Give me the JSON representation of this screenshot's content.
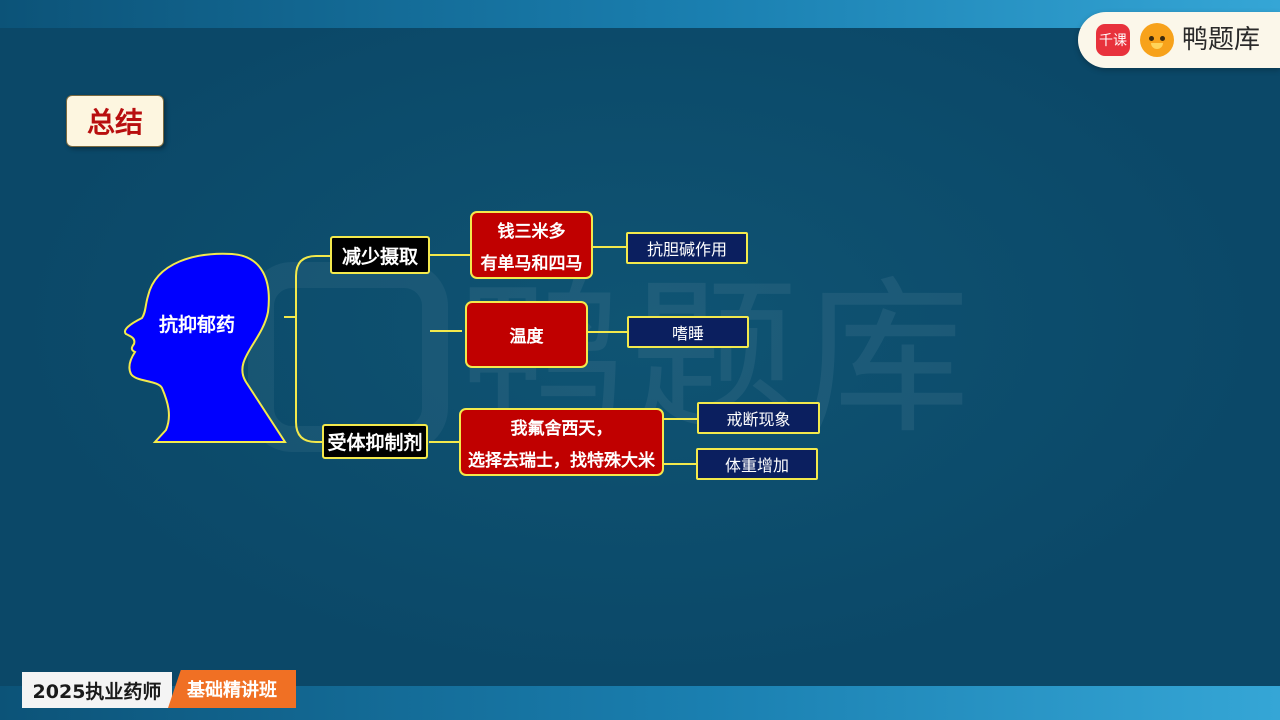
{
  "brand": {
    "badge": "千课",
    "name": "鸭题库"
  },
  "summary_label": "总结",
  "watermark": "鸭题库",
  "mindmap": {
    "root": "抗抑郁药",
    "branches": [
      {
        "label": "减少摄取",
        "mnemonic": [
          "钱三米多",
          "有单马和四马"
        ],
        "effects": [
          "抗胆碱作用"
        ]
      },
      {
        "label": "",
        "mnemonic": [
          "温度"
        ],
        "effects": [
          "嗜睡"
        ]
      },
      {
        "label": "受体抑制剂",
        "mnemonic": [
          "我氟舍西天，",
          "选择去瑞士，找特殊大米"
        ],
        "effects": [
          "戒断现象",
          "体重增加"
        ]
      }
    ]
  },
  "footer": {
    "course": "2025执业药师",
    "tag": "基础精讲班"
  },
  "colors": {
    "background": "#0b4868",
    "node_red": "#c00000",
    "node_navy": "#0b1f5f",
    "head_blue": "#0000ff",
    "connector": "#f3e94c"
  }
}
